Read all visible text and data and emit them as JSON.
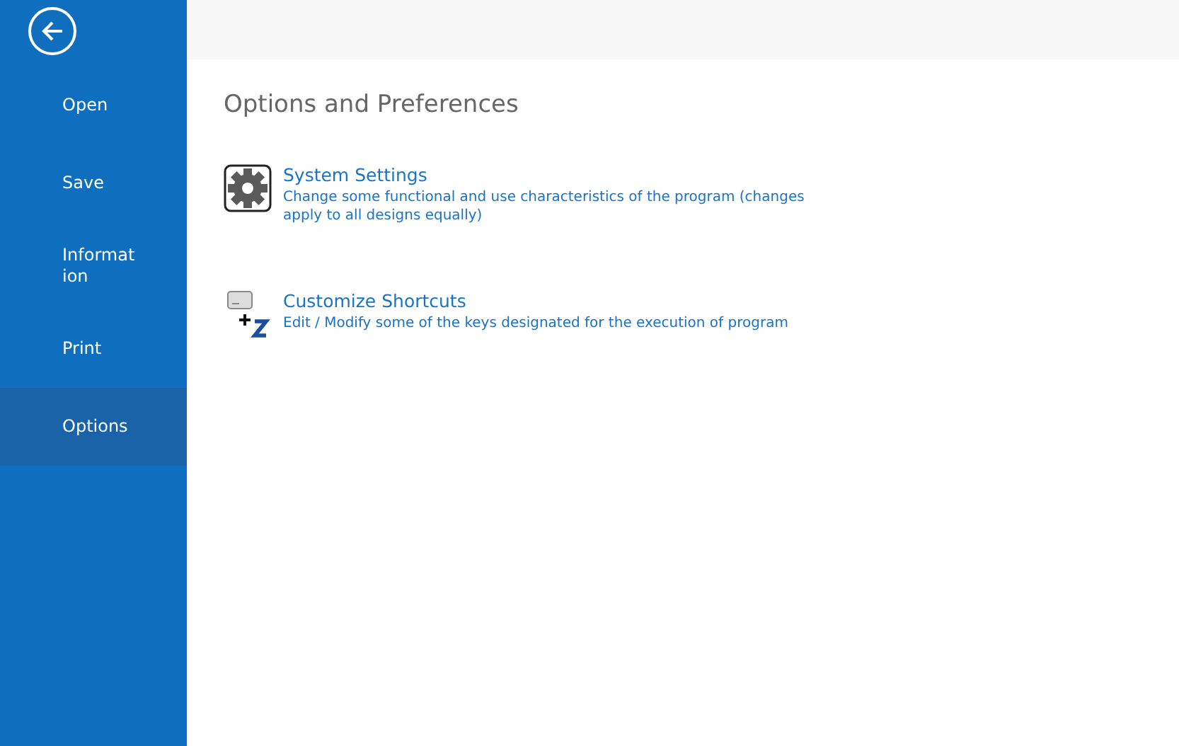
{
  "sidebar": {
    "items": [
      {
        "label": "Open",
        "selected": false
      },
      {
        "label": "Save",
        "selected": false
      },
      {
        "label": "Information",
        "selected": false
      },
      {
        "label": "Print",
        "selected": false
      },
      {
        "label": "Options",
        "selected": true
      }
    ]
  },
  "main": {
    "title": "Options and Preferences",
    "entries": [
      {
        "kind": "settings",
        "title": "System Settings",
        "description": "Change some functional and use characteristics of the program (changes apply to all designs equally)"
      },
      {
        "kind": "shortcuts",
        "title": "Customize Shortcuts",
        "description": "Edit / Modify some of the keys designated for the execution of program"
      }
    ]
  }
}
